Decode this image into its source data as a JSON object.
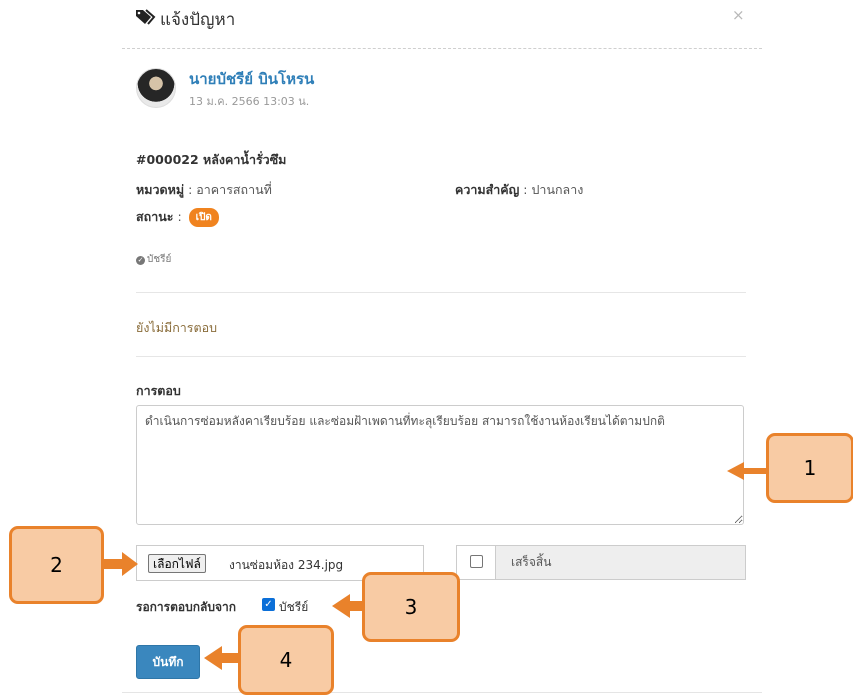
{
  "header": {
    "title": "แจ้งปัญหา",
    "close_label": "×"
  },
  "author": {
    "name": "นายบัชรีย์ บินโหรน",
    "time": "13 ม.ค. 2566 13:03 น."
  },
  "ticket": {
    "title": "#000022 หลังคาน้ำรั่วซึม",
    "category_label": "หมวดหมู่",
    "category_value": "อาคารสถานที่",
    "priority_label": "ความสำคัญ",
    "priority_value": "ปานกลาง",
    "status_label": "สถานะ",
    "status_value": "เปิด",
    "tag": "บัชรีย์"
  },
  "replies": {
    "empty_text": "ยังไม่มีการตอบ"
  },
  "reply_form": {
    "label": "การตอบ",
    "text": "ดำเนินการซ่อมหลังคาเรียบร้อย และซ่อมฝ้าเพดานที่ทะลุเรียบร้อย สามารถใช้งานห้องเรียนได้ตามปกติ",
    "file_button": "เลือกไฟล์",
    "file_name": "งานซ่อมห้อง 234.jpg",
    "done_label": "เสร็จสิ้น",
    "wait_label": "รอการตอบกลับจาก",
    "wait_name": "บัชรีย์",
    "save_label": "บันทึก"
  },
  "callouts": [
    "1",
    "2",
    "3",
    "4"
  ],
  "colors": {
    "accent": "#3a87be",
    "badge": "#f0831f",
    "callout_fill": "#f8cba4",
    "callout_border": "#e9822b"
  },
  "icons": {
    "header": "tag-icon",
    "tag": "check-circle-icon"
  }
}
